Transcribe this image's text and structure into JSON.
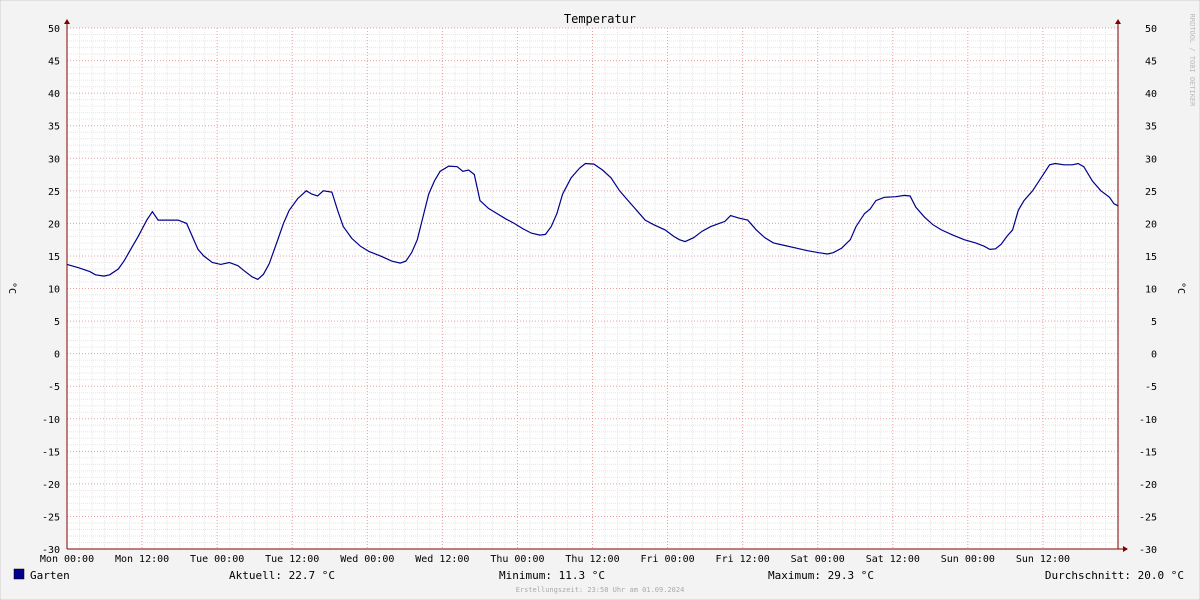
{
  "chart_data": {
    "type": "line",
    "title": "Temperatur",
    "ylabel": "°C",
    "ylim": [
      -30,
      50
    ],
    "yticks": [
      50,
      45,
      40,
      35,
      30,
      25,
      20,
      15,
      10,
      5,
      0,
      -5,
      -10,
      -15,
      -20,
      -25,
      -30
    ],
    "xlim": [
      0,
      168
    ],
    "xticks": [
      {
        "x": 0,
        "label": "Mon 00:00"
      },
      {
        "x": 12,
        "label": "Mon 12:00"
      },
      {
        "x": 24,
        "label": "Tue 00:00"
      },
      {
        "x": 36,
        "label": "Tue 12:00"
      },
      {
        "x": 48,
        "label": "Wed 00:00"
      },
      {
        "x": 60,
        "label": "Wed 12:00"
      },
      {
        "x": 72,
        "label": "Thu 00:00"
      },
      {
        "x": 84,
        "label": "Thu 12:00"
      },
      {
        "x": 96,
        "label": "Fri 00:00"
      },
      {
        "x": 108,
        "label": "Fri 12:00"
      },
      {
        "x": 120,
        "label": "Sat 00:00"
      },
      {
        "x": 132,
        "label": "Sat 12:00"
      },
      {
        "x": 144,
        "label": "Sun 00:00"
      },
      {
        "x": 156,
        "label": "Sun 12:00"
      }
    ],
    "grid": true,
    "series": [
      {
        "name": "Garten",
        "color": "#00008b",
        "points": [
          [
            0,
            13.7
          ],
          [
            2,
            13.2
          ],
          [
            4,
            12.6
          ],
          [
            5,
            12.1
          ],
          [
            6.5,
            11.9
          ],
          [
            7.5,
            12.1
          ],
          [
            9,
            13.0
          ],
          [
            10,
            14.2
          ],
          [
            11.5,
            16.5
          ],
          [
            12.5,
            18.0
          ],
          [
            14,
            20.5
          ],
          [
            15,
            21.8
          ],
          [
            16,
            20.5
          ],
          [
            18,
            20.5
          ],
          [
            19.5,
            20.5
          ],
          [
            21,
            20.0
          ],
          [
            22,
            18.0
          ],
          [
            23,
            16.0
          ],
          [
            24,
            15.0
          ],
          [
            25.5,
            14.0
          ],
          [
            27,
            13.7
          ],
          [
            28.5,
            14.0
          ],
          [
            30,
            13.5
          ],
          [
            31,
            12.8
          ],
          [
            32.5,
            11.8
          ],
          [
            33.5,
            11.4
          ],
          [
            34.5,
            12.2
          ],
          [
            35.5,
            13.8
          ],
          [
            37,
            17.5
          ],
          [
            38,
            20.0
          ],
          [
            39,
            22.0
          ],
          [
            40.5,
            23.8
          ],
          [
            42,
            25.0
          ],
          [
            43,
            24.5
          ],
          [
            44,
            24.2
          ],
          [
            45,
            25.0
          ],
          [
            46.5,
            24.8
          ],
          [
            47.5,
            22.0
          ],
          [
            48.5,
            19.5
          ],
          [
            50,
            17.7
          ],
          [
            51.5,
            16.5
          ],
          [
            53,
            15.7
          ],
          [
            55,
            15.0
          ],
          [
            57,
            14.2
          ],
          [
            58.5,
            13.9
          ],
          [
            59.5,
            14.2
          ],
          [
            60.5,
            15.5
          ],
          [
            61.5,
            17.5
          ],
          [
            62.5,
            21.0
          ],
          [
            63.5,
            24.5
          ],
          [
            64.5,
            26.5
          ],
          [
            65.5,
            28.0
          ],
          [
            67,
            28.8
          ],
          [
            68.5,
            28.7
          ],
          [
            69.5,
            28.0
          ],
          [
            70.5,
            28.2
          ],
          [
            71.5,
            27.5
          ],
          [
            72.5,
            23.5
          ],
          [
            74,
            22.3
          ],
          [
            75.5,
            21.5
          ],
          [
            77,
            20.7
          ],
          [
            78.5,
            20.0
          ],
          [
            80,
            19.2
          ],
          [
            81.5,
            18.5
          ],
          [
            83,
            18.2
          ],
          [
            84,
            18.3
          ],
          [
            85,
            19.5
          ],
          [
            86,
            21.5
          ],
          [
            87,
            24.5
          ],
          [
            88.5,
            27.0
          ],
          [
            90,
            28.5
          ],
          [
            91,
            29.2
          ],
          [
            92.5,
            29.1
          ],
          [
            94,
            28.2
          ],
          [
            95.5,
            27.0
          ],
          [
            97,
            25.0
          ],
          [
            98.5,
            23.5
          ],
          [
            100,
            22.0
          ],
          [
            101.5,
            20.5
          ],
          [
            103,
            19.8
          ],
          [
            105,
            19.0
          ],
          [
            106.5,
            18.0
          ],
          [
            107.5,
            17.5
          ],
          [
            108.5,
            17.2
          ],
          [
            110,
            17.8
          ],
          [
            111.5,
            18.8
          ],
          [
            113,
            19.5
          ],
          [
            114.5,
            20.0
          ],
          [
            115.5,
            20.3
          ],
          [
            116.5,
            21.2
          ],
          [
            118,
            20.8
          ],
          [
            119.5,
            20.5
          ],
          [
            121,
            19.0
          ],
          [
            122.5,
            17.8
          ],
          [
            124,
            17.0
          ],
          [
            126,
            16.6
          ],
          [
            128,
            16.2
          ],
          [
            130,
            15.8
          ],
          [
            132,
            15.5
          ],
          [
            133.5,
            15.3
          ],
          [
            134.5,
            15.5
          ],
          [
            136,
            16.2
          ],
          [
            137.5,
            17.5
          ],
          [
            138.5,
            19.5
          ],
          [
            140,
            21.5
          ],
          [
            141,
            22.2
          ],
          [
            142,
            23.5
          ],
          [
            143.5,
            24.0
          ],
          [
            145.5,
            24.1
          ],
          [
            147,
            24.3
          ],
          [
            148,
            24.2
          ],
          [
            149,
            22.5
          ],
          [
            150.5,
            21.0
          ],
          [
            152,
            19.8
          ],
          [
            153.5,
            19.0
          ],
          [
            155.5,
            18.2
          ],
          [
            157.5,
            17.5
          ],
          [
            159.5,
            17.0
          ],
          [
            161,
            16.5
          ],
          [
            162,
            16.0
          ],
          [
            163,
            16.1
          ],
          [
            164,
            16.8
          ],
          [
            165,
            18.0
          ],
          [
            166,
            19.0
          ],
          [
            167,
            22.0
          ],
          [
            168,
            23.5
          ],
          [
            169.5,
            25.0
          ],
          [
            171,
            27.0
          ],
          [
            172.5,
            29.0
          ],
          [
            173.5,
            29.2
          ],
          [
            175,
            29.0
          ],
          [
            176.5,
            29.0
          ],
          [
            177.5,
            29.2
          ],
          [
            178.5,
            28.7
          ],
          [
            180,
            26.5
          ],
          [
            181.5,
            25.0
          ],
          [
            183,
            24.0
          ],
          [
            183.8,
            23.0
          ],
          [
            184.5,
            22.7
          ]
        ]
      }
    ]
  },
  "legend": {
    "series_name": "Garten",
    "current": "Aktuell: 22.7 °C",
    "minimum": "Minimum: 11.3 °C",
    "maximum": "Maximum: 29.3 °C",
    "average": "Durchschnitt: 20.0 °C"
  },
  "footer": "Erstellungszeit: 23:58 Uhr am 01.09.2024",
  "watermark": "RRDTOOL / TOBI OETIKER",
  "colors": {
    "background": "#f3f3f3",
    "plot": "#ffffff",
    "line": "#00008b",
    "minor_grid": "#e6e6e6",
    "major_grid": "#e8a0a0",
    "axis": "#800000"
  }
}
